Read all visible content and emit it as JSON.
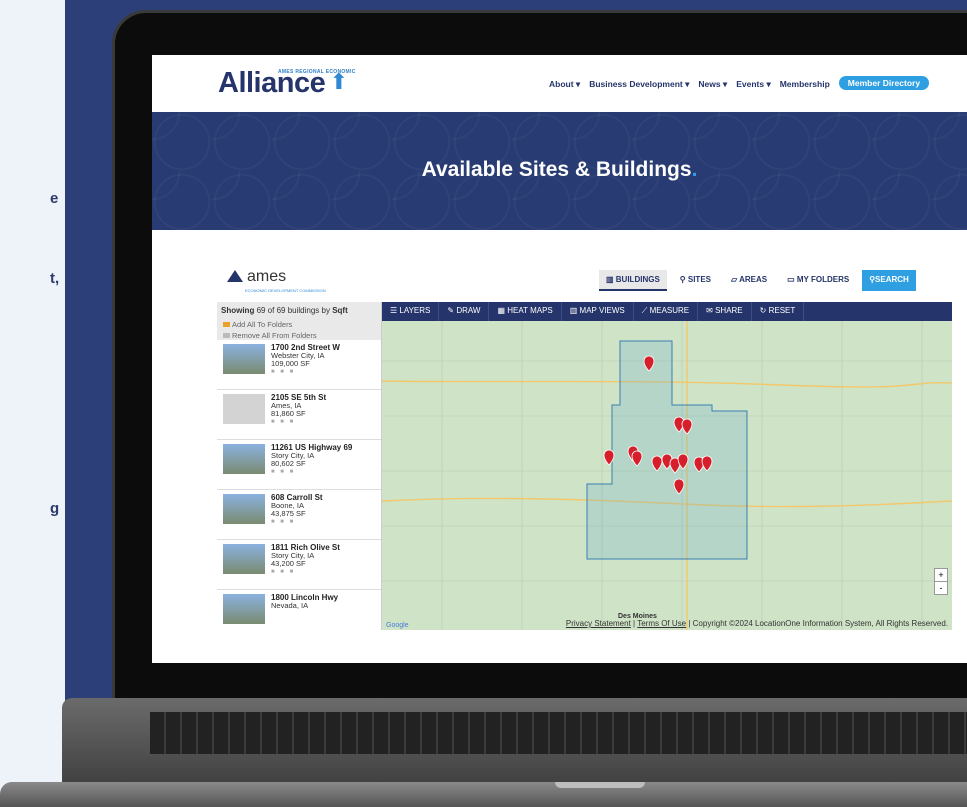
{
  "left_fragments": [
    "e",
    "t,",
    "g"
  ],
  "site": {
    "logo_tagline": "AMES REGIONAL ECONOMIC",
    "logo_word": "Alliance",
    "nav": [
      "About ▾",
      "Business Development ▾",
      "News ▾",
      "Events ▾",
      "Membership"
    ],
    "member_directory": "Member Directory",
    "hero_title": "Available Sites & Buildings",
    "hero_dot": "."
  },
  "app": {
    "logo_word": "ames",
    "logo_sub": "ECONOMIC DEVELOPMENT COMMISSION",
    "tabs": [
      "BUILDINGS",
      "SITES",
      "AREAS",
      "MY FOLDERS",
      "SEARCH"
    ],
    "tools": [
      "LAYERS",
      "DRAW",
      "HEAT MAPS",
      "MAP VIEWS",
      "MEASURE",
      "SHARE",
      "RESET"
    ],
    "list_header_prefix": "Showing",
    "list_header_count": "69 of 69 buildings by",
    "list_header_sort": "Sqft",
    "add_all": "Add All To Folders",
    "remove_all": "Remove All From Folders",
    "items": [
      {
        "addr": "1700 2nd Street W",
        "city": "Webster City, IA",
        "sqft": "109,000 SF"
      },
      {
        "addr": "2105 SE 5th St",
        "city": "Ames, IA",
        "sqft": "81,860 SF"
      },
      {
        "addr": "11261 US Highway 69",
        "city": "Story City, IA",
        "sqft": "80,602 SF"
      },
      {
        "addr": "608 Carroll St",
        "city": "Boone, IA",
        "sqft": "43,875 SF"
      },
      {
        "addr": "1811 Rich Olive St",
        "city": "Story City, IA",
        "sqft": "43,200 SF"
      },
      {
        "addr": "1800 Lincoln Hwy",
        "city": "Nevada, IA",
        "sqft": ""
      }
    ],
    "zoom_in": "+",
    "zoom_out": "-",
    "map_logo": "Google",
    "map_city": "Des Moines",
    "privacy": "Privacy Statement",
    "terms": "Terms Of Use",
    "copyright": "Copyright ©2024 LocationOne Information System, All Rights Reserved."
  }
}
